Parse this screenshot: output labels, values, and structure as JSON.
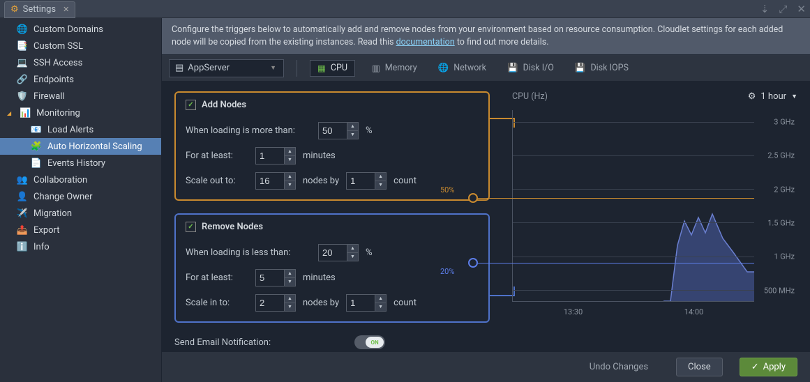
{
  "window": {
    "title": "Settings"
  },
  "titlebar_icons": [
    "download",
    "expand",
    "close"
  ],
  "sidebar": {
    "items": [
      {
        "label": "Custom Domains",
        "icon": "🌐"
      },
      {
        "label": "Custom SSL",
        "icon": "📑"
      },
      {
        "label": "SSH Access",
        "icon": "💻"
      },
      {
        "label": "Endpoints",
        "icon": "🔗"
      },
      {
        "label": "Firewall",
        "icon": "🛡️"
      },
      {
        "label": "Monitoring",
        "icon": "📊",
        "expanded": true,
        "children": [
          {
            "label": "Load Alerts",
            "icon": "📧"
          },
          {
            "label": "Auto Horizontal Scaling",
            "icon": "🧩",
            "selected": true
          },
          {
            "label": "Events History",
            "icon": "📄"
          }
        ]
      },
      {
        "label": "Collaboration",
        "icon": "👥"
      },
      {
        "label": "Change Owner",
        "icon": "👤"
      },
      {
        "label": "Migration",
        "icon": "✈️"
      },
      {
        "label": "Export",
        "icon": "📤"
      },
      {
        "label": "Info",
        "icon": "ℹ️"
      }
    ]
  },
  "info_text": "Configure the triggers below to automatically add and remove nodes from your environment based on resource consumption. Cloudlet settings for each added node will be copied from the existing instances. Read this ",
  "info_link": "documentation",
  "info_tail": " to find out more details.",
  "server": {
    "label": "AppServer"
  },
  "metrics": [
    {
      "label": "CPU",
      "icon": "cpu",
      "active": true
    },
    {
      "label": "Memory",
      "icon": "ram"
    },
    {
      "label": "Network",
      "icon": "net"
    },
    {
      "label": "Disk I/O",
      "icon": "disk"
    },
    {
      "label": "Disk IOPS",
      "icon": "disk"
    }
  ],
  "add": {
    "title": "Add Nodes",
    "checked": true,
    "row1_label": "When loading is more than:",
    "threshold": "50",
    "threshold_unit": "%",
    "row2_label": "For at least:",
    "duration": "1",
    "duration_unit": "minutes",
    "row3_label": "Scale out to:",
    "limit": "16",
    "mid": "nodes by",
    "step": "1",
    "tail": "count"
  },
  "remove": {
    "title": "Remove Nodes",
    "checked": true,
    "row1_label": "When loading is less than:",
    "threshold": "20",
    "threshold_unit": "%",
    "row2_label": "For at least:",
    "duration": "5",
    "duration_unit": "minutes",
    "row3_label": "Scale in to:",
    "limit": "2",
    "mid": "nodes by",
    "step": "1",
    "tail": "count"
  },
  "notify": {
    "label": "Send Email Notification:",
    "state": "ON"
  },
  "chart": {
    "title": "CPU (Hz)",
    "range": "1 hour",
    "yticks": [
      "3 GHz",
      "2.5 GHz",
      "2 GHz",
      "1.5 GHz",
      "1 GHz",
      "500 MHz"
    ],
    "xticks": [
      "13:30",
      "14:00"
    ],
    "threshold_add": "50%",
    "threshold_remove": "20%"
  },
  "actions": {
    "undo": "Undo Changes",
    "close": "Close",
    "apply": "Apply"
  },
  "chart_data": {
    "type": "line",
    "title": "CPU (Hz)",
    "xlabel": "",
    "ylabel": "Hz",
    "ylim": [
      0,
      3000
    ],
    "x_range": [
      "13:08",
      "14:08"
    ],
    "series": [
      {
        "name": "CPU",
        "x": [
          "13:08",
          "13:50",
          "13:52",
          "13:54",
          "13:56",
          "13:58",
          "14:00",
          "14:02",
          "14:04",
          "14:06",
          "14:08"
        ],
        "values": [
          0,
          0,
          900,
          1250,
          1050,
          1300,
          1050,
          1350,
          1000,
          800,
          500
        ]
      }
    ],
    "thresholds": [
      {
        "name": "add",
        "value": 1500,
        "label": "50%",
        "color": "#c98a2f"
      },
      {
        "name": "remove",
        "value": 600,
        "label": "20%",
        "color": "#5c7de8"
      }
    ]
  }
}
